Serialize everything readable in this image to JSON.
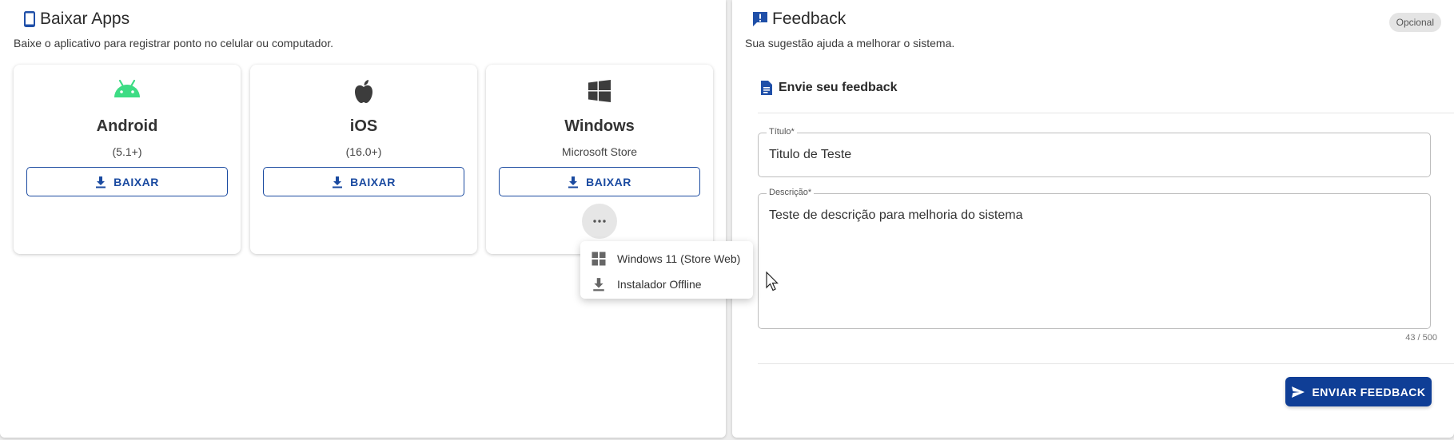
{
  "apps": {
    "title": "Baixar Apps",
    "subtitle": "Baixe o aplicativo para registrar ponto no celular ou computador.",
    "cards": [
      {
        "name": "Android",
        "version": "(5.1+)",
        "icon": "android-icon",
        "button": "BAIXAR"
      },
      {
        "name": "iOS",
        "version": "(16.0+)",
        "icon": "apple-icon",
        "button": "BAIXAR"
      },
      {
        "name": "Windows",
        "version": "Microsoft Store",
        "icon": "windows-icon",
        "button": "BAIXAR"
      }
    ],
    "more_icon": "more-horizontal-icon",
    "menu": [
      {
        "label": "Windows 11 (Store Web)",
        "icon": "windows-grid-icon"
      },
      {
        "label": "Instalador Offline",
        "icon": "download-icon"
      }
    ]
  },
  "feedback": {
    "title": "Feedback",
    "subtitle": "Sua sugestão ajuda a melhorar o sistema.",
    "badge": "Opcional",
    "section": "Envie seu feedback",
    "title_field": {
      "label": "Título*",
      "value": "Titulo de Teste"
    },
    "description_field": {
      "label": "Descrição*",
      "value": "Teste de descrição para melhoria do sistema"
    },
    "char_count": "43 / 500",
    "submit": "ENVIAR FEEDBACK"
  },
  "colors": {
    "primary": "#0f3e96",
    "android_green": "#3ddc84",
    "outline_blue": "#1a4aa0"
  }
}
